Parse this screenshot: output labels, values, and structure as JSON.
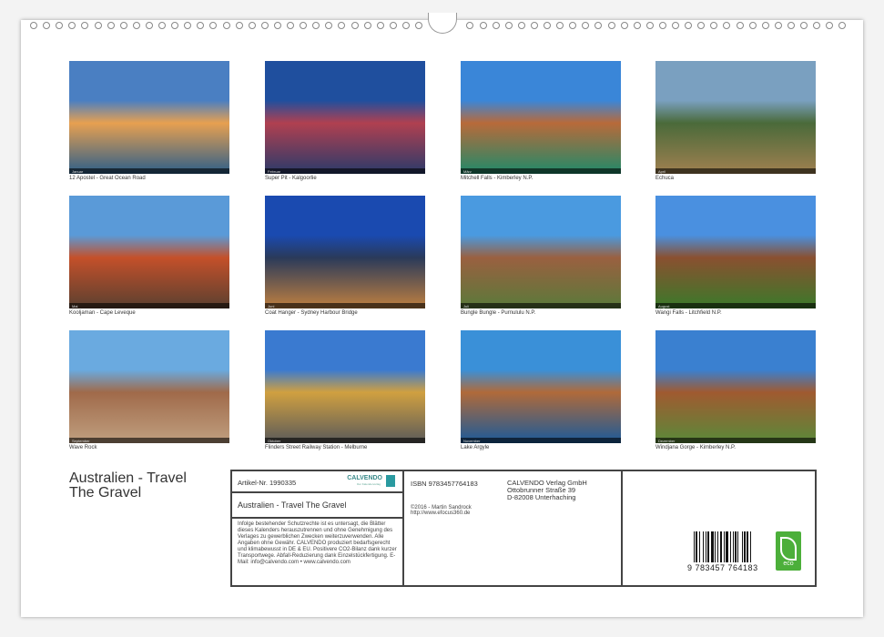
{
  "photos": [
    {
      "caption": "12 Apostel - Great Ocean Road",
      "month": "Januar",
      "colors": [
        "#4a7fc2",
        "#e7a050",
        "#2c5e8a"
      ]
    },
    {
      "caption": "Super Pit - Kalgoorlie",
      "month": "Februar",
      "colors": [
        "#1f4f9e",
        "#b04050",
        "#2a3a6a"
      ]
    },
    {
      "caption": "Mitchell Falls - Kimberley N.P.",
      "month": "März",
      "colors": [
        "#3a86d8",
        "#b86a3a",
        "#1f8a6a"
      ]
    },
    {
      "caption": "Echuca",
      "month": "April",
      "colors": [
        "#7aa0c0",
        "#4a6a3a",
        "#a08050"
      ]
    },
    {
      "caption": "Kooljaman - Cape Leveque",
      "month": "Mai",
      "colors": [
        "#5a9ad8",
        "#c4502a",
        "#5a4030"
      ]
    },
    {
      "caption": "Coat Hanger - Sydney Harbour Bridge",
      "month": "Juni",
      "colors": [
        "#1a4ab0",
        "#2a3a5a",
        "#c08040"
      ]
    },
    {
      "caption": "Bungle Bungle - Purnululu N.P.",
      "month": "Juli",
      "colors": [
        "#4a9ae0",
        "#9a6040",
        "#5a7a3a"
      ]
    },
    {
      "caption": "Wangi Falls - Litchfield N.P.",
      "month": "August",
      "colors": [
        "#4a90e0",
        "#8a5030",
        "#3a7a2a"
      ]
    },
    {
      "caption": "Wave Rock",
      "month": "September",
      "colors": [
        "#6aaae0",
        "#a06a4a",
        "#c0a080"
      ]
    },
    {
      "caption": "Flinders Street Railway Station - Melburne",
      "month": "Oktober",
      "colors": [
        "#3a7ad0",
        "#d0a040",
        "#5a5a5a"
      ]
    },
    {
      "caption": "Lake Argyle",
      "month": "November",
      "colors": [
        "#3a90d8",
        "#b06a3a",
        "#1a5a9a"
      ]
    },
    {
      "caption": "Windjana Gorge - Kimberley N.P.",
      "month": "Dezember",
      "colors": [
        "#3a80d0",
        "#a05a30",
        "#5a8a3a"
      ]
    }
  ],
  "title_line1": "Australien - Travel",
  "title_line2": "The Gravel",
  "info": {
    "article": "Artikel-Nr. 1990335",
    "brand": "CALVENDO",
    "brand_sub": "Der Kalenderverlag",
    "product_title": "Australien - Travel The Gravel",
    "legal": "Infolge bestehender Schutzrechte ist es untersagt, die Blätter dieses Kalenders herauszutrennen und ohne Genehmigung des Verlages zu gewerblichen Zwecken weiterzuverwenden. Alle Angaben ohne Gewähr. CALVENDO produziert bedarfsgerecht und klimabewusst in DE & EU. Positivere CO2-Bilanz dank kurzer Transportwege. Abfall-Reduzierung dank Einzelstückfertigung. E-Mail: info@calvendo.com • www.calvendo.com",
    "isbn": "ISBN 9783457764183",
    "copyright": "©2016 - Martin Sandrock",
    "website": "http://www.efocus360.de",
    "publisher1": "CALVENDO Verlag GmbH",
    "publisher2": "Ottobrunner Straße 39",
    "publisher3": "D-82008 Unterhaching",
    "barcode_digits": "9 783457 764183",
    "eco_label": "eco"
  }
}
